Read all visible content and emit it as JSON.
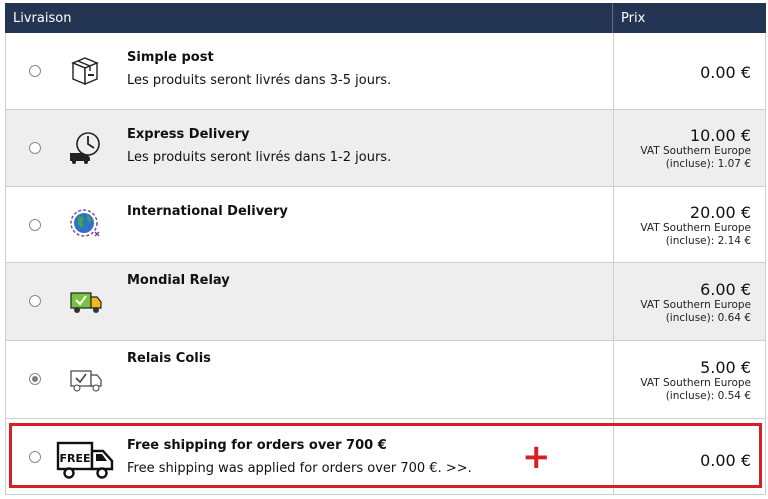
{
  "header": {
    "delivery": "Livraison",
    "price": "Prix"
  },
  "options": [
    {
      "name": "Simple post",
      "description": "Les produits seront livrés dans 3-5 jours.",
      "price": "0.00 €",
      "vat_line1": "",
      "vat_line2": "",
      "selected": false,
      "icon": "package-box-icon"
    },
    {
      "name": "Express Delivery",
      "description": "Les produits seront livrés dans 1-2 jours.",
      "price": "10.00 €",
      "vat_line1": "VAT Southern Europe",
      "vat_line2": "(incluse): 1.07 €",
      "selected": false,
      "icon": "clock-truck-icon"
    },
    {
      "name": "International Delivery",
      "description": "",
      "price": "20.00 €",
      "vat_line1": "VAT Southern Europe",
      "vat_line2": "(incluse): 2.14 €",
      "selected": false,
      "icon": "globe-icon"
    },
    {
      "name": "Mondial Relay",
      "description": "",
      "price": "6.00 €",
      "vat_line1": "VAT Southern Europe",
      "vat_line2": "(incluse): 0.64 €",
      "selected": false,
      "icon": "green-truck-icon"
    },
    {
      "name": "Relais Colis",
      "description": "",
      "price": "5.00 €",
      "vat_line1": "VAT Southern Europe",
      "vat_line2": "(incluse): 0.54 €",
      "selected": true,
      "icon": "checked-truck-icon"
    },
    {
      "name": "Free shipping for orders over 700 €",
      "description": "Free shipping was applied for orders over 700 €. >>.",
      "price": "0.00 €",
      "vat_line1": "",
      "vat_line2": "",
      "selected": false,
      "icon": "free-truck-icon"
    }
  ],
  "free_icon_text": "FREE",
  "annotation": {
    "plus_sign": "+",
    "highlight_color": "#d42027"
  }
}
